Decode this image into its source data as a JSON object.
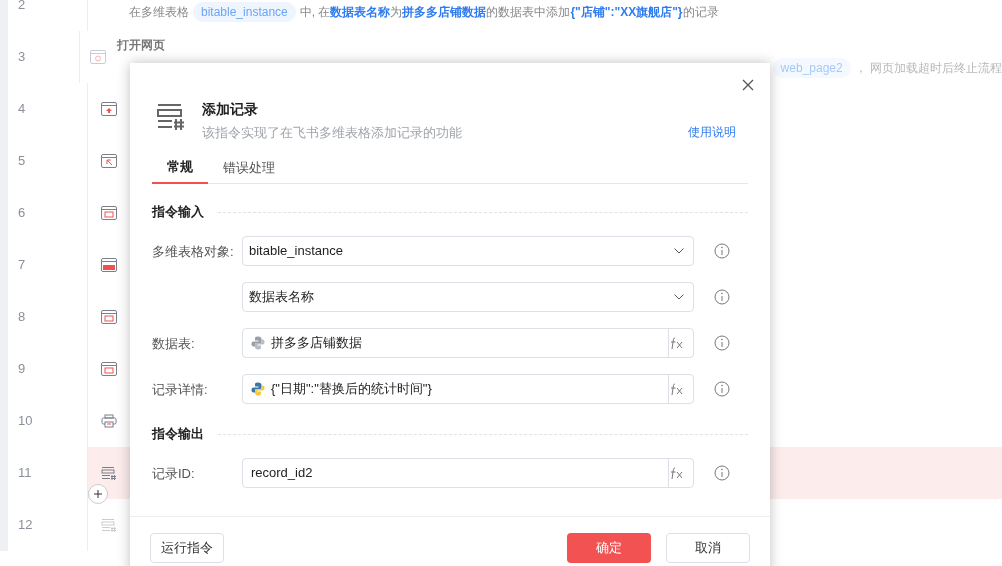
{
  "steps": [
    {
      "number": "2",
      "selected": false,
      "description": [
        {
          "kind": "text",
          "text": "在多维表格"
        },
        {
          "kind": "chip",
          "text": "bitable_instance"
        },
        {
          "kind": "text",
          "text": "中, 在"
        },
        {
          "kind": "strong",
          "text": "数据表名称"
        },
        {
          "kind": "text",
          "text": "为"
        },
        {
          "kind": "strong",
          "text": "拼多多店铺数据"
        },
        {
          "kind": "text",
          "text": "的数据表中添加"
        },
        {
          "kind": "strong",
          "text": "{\"店铺\":\"XX旗舰店\"}"
        },
        {
          "kind": "text",
          "text": "的记录"
        }
      ]
    },
    {
      "number": "3",
      "kind": "web-open",
      "selected": false,
      "disabled": true,
      "title": "打开网页",
      "description": [
        {
          "kind": "chip",
          "text": "web_page2"
        },
        {
          "kind": "text",
          "text": "， 网页加载超时后终止流程"
        }
      ]
    },
    {
      "number": "4",
      "kind": "web-upload",
      "selected": false,
      "disabled": false
    },
    {
      "number": "5",
      "kind": "web-click",
      "selected": false,
      "disabled": false
    },
    {
      "number": "6",
      "kind": "web-element",
      "selected": false,
      "disabled": false
    },
    {
      "number": "7",
      "kind": "web-code",
      "selected": false,
      "disabled": false
    },
    {
      "number": "8",
      "kind": "web-element",
      "selected": false,
      "disabled": false
    },
    {
      "number": "9",
      "kind": "web-element",
      "selected": false,
      "disabled": false
    },
    {
      "number": "10",
      "kind": "printer",
      "selected": false,
      "disabled": false
    },
    {
      "number": "11",
      "kind": "record-add",
      "selected": true,
      "disabled": false
    },
    {
      "number": "12",
      "kind": "record-add",
      "selected": false,
      "disabled": true
    }
  ],
  "dialog": {
    "title": "添加记录",
    "subtitle": "该指令实现了在飞书多维表格添加记录的功能",
    "help_link": "使用说明",
    "tabs": [
      {
        "label": "常规",
        "selected": true
      },
      {
        "label": "错误处理",
        "selected": false
      }
    ],
    "sections": [
      {
        "title": "指令输入",
        "fields": [
          {
            "label": "多维表格对象:",
            "kind": "select",
            "value": "bitable_instance"
          },
          {
            "kind": "select",
            "value": "数据表名称"
          },
          {
            "label": "数据表:",
            "kind": "python",
            "disabled": true,
            "value": "拼多多店铺数据"
          },
          {
            "label": "记录详情:",
            "kind": "python",
            "disabled": false,
            "value": "{\"日期\":\"替换后的统计时间\"}"
          }
        ]
      },
      {
        "title": "指令输出",
        "fields": [
          {
            "label": "记录ID:",
            "kind": "expr",
            "value": "record_id2"
          }
        ]
      }
    ],
    "buttons": {
      "run": "运行指令",
      "ok": "确定",
      "cancel": "取消"
    }
  }
}
